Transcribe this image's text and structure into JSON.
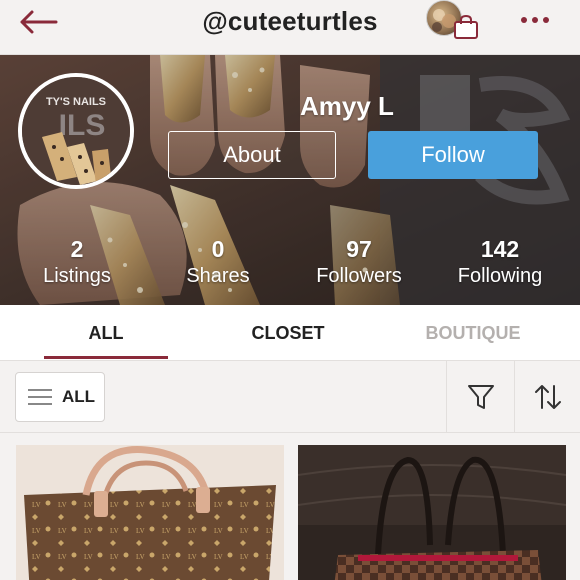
{
  "header": {
    "username": "@cuteeturtles",
    "back_icon": "arrow-left-icon",
    "bag_icon": "shopping-bag-icon",
    "more_icon": "more-dots-icon"
  },
  "profile": {
    "name": "Amyy L",
    "avatar_text": "TY'S NAILS",
    "about_label": "About",
    "follow_label": "Follow",
    "stats": [
      {
        "value": "2",
        "label": "Listings"
      },
      {
        "value": "0",
        "label": "Shares"
      },
      {
        "value": "97",
        "label": "Followers"
      },
      {
        "value": "142",
        "label": "Following"
      }
    ]
  },
  "tabs": [
    {
      "label": "ALL",
      "active": true
    },
    {
      "label": "CLOSET",
      "active": false
    },
    {
      "label": "BOUTIQUE",
      "active": false
    }
  ],
  "filter": {
    "category_label": "ALL",
    "filter_icon": "funnel-icon",
    "sort_icon": "sort-arrows-icon"
  },
  "colors": {
    "accent": "#8a2a3a",
    "follow_button": "#49a0dc",
    "inactive_tab": "#b4b0ae"
  }
}
